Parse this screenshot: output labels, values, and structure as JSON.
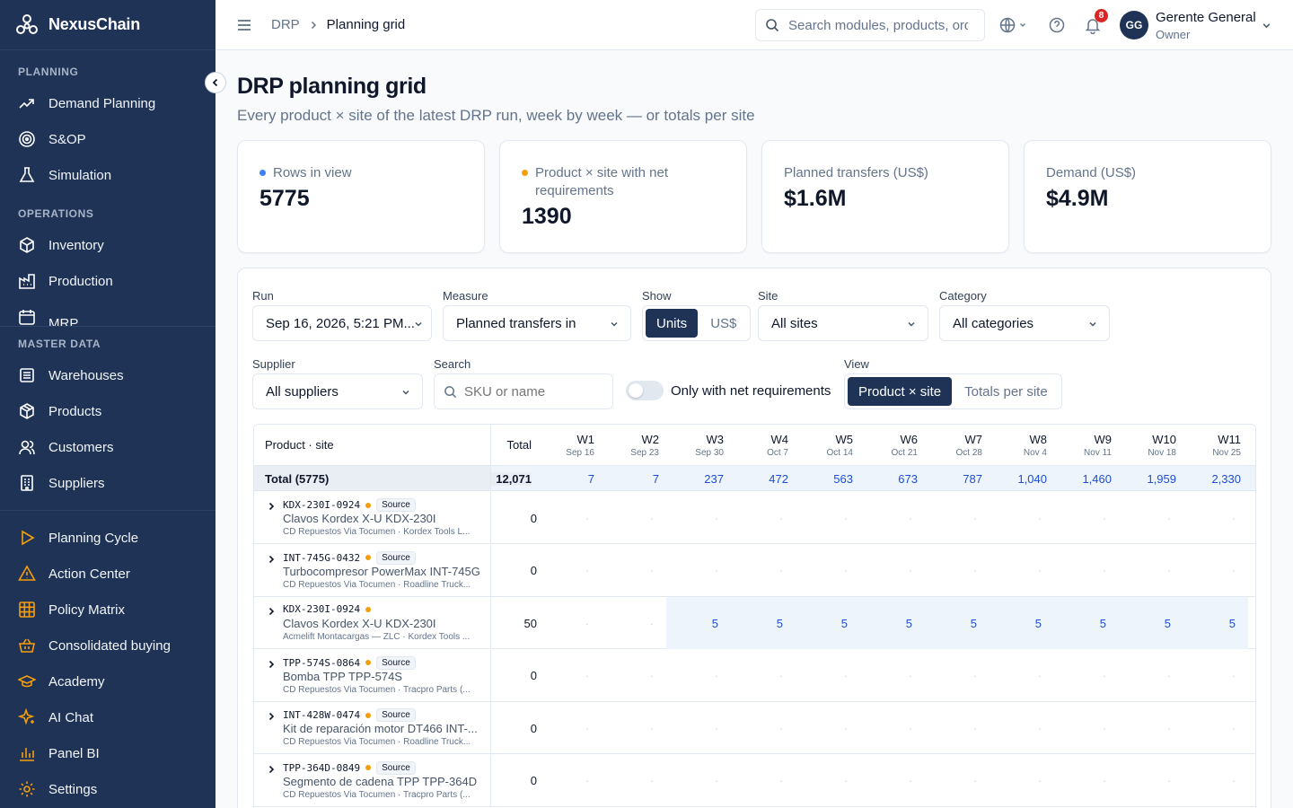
{
  "app": {
    "brand": "NexusChain"
  },
  "sidebar": {
    "sections": {
      "planning": "PLANNING",
      "operations": "OPERATIONS",
      "master_data": "MASTER DATA"
    },
    "planning_items": [
      {
        "label": "Demand Planning",
        "icon": "trend-up-icon"
      },
      {
        "label": "S&OP",
        "icon": "target-icon"
      },
      {
        "label": "Simulation",
        "icon": "flask-icon"
      }
    ],
    "operations_items": [
      {
        "label": "Inventory",
        "icon": "box-icon"
      },
      {
        "label": "Production",
        "icon": "factory-icon"
      },
      {
        "label": "MRP",
        "icon": "calendar-icon"
      }
    ],
    "master_items": [
      {
        "label": "Warehouses",
        "icon": "warehouse-icon"
      },
      {
        "label": "Products",
        "icon": "package-icon"
      },
      {
        "label": "Customers",
        "icon": "users-icon"
      },
      {
        "label": "Suppliers",
        "icon": "building-icon"
      }
    ],
    "bottom_items": [
      {
        "label": "Planning Cycle",
        "icon": "play-icon"
      },
      {
        "label": "Action Center",
        "icon": "alert-triangle-icon"
      },
      {
        "label": "Policy Matrix",
        "icon": "grid-icon"
      },
      {
        "label": "Consolidated buying",
        "icon": "basket-icon"
      },
      {
        "label": "Academy",
        "icon": "graduation-cap-icon"
      },
      {
        "label": "AI Chat",
        "icon": "sparkles-icon"
      },
      {
        "label": "Panel BI",
        "icon": "bar-chart-icon"
      },
      {
        "label": "Settings",
        "icon": "gear-icon"
      }
    ]
  },
  "topbar": {
    "breadcrumb_root": "DRP",
    "breadcrumb_current": "Planning grid",
    "search_placeholder": "Search modules, products, orders",
    "notifications": "8",
    "avatar_initials": "GG",
    "user_name": "Gerente General",
    "user_role": "Owner"
  },
  "page": {
    "title": "DRP planning grid",
    "subtitle": "Every product × site of the latest DRP run, week by week — or totals per site"
  },
  "kpis": [
    {
      "label": "Rows in view",
      "value": "5775",
      "dot_color": "#3b82f6"
    },
    {
      "label": "Product × site with net requirements",
      "value": "1390",
      "dot_color": "#f59e0b"
    },
    {
      "label": "Planned transfers (US$)",
      "value": "$1.6M"
    },
    {
      "label": "Demand (US$)",
      "value": "$4.9M"
    }
  ],
  "filters": {
    "run_label": "Run",
    "run_value": "Sep 16, 2026, 5:21 PM...",
    "measure_label": "Measure",
    "measure_value": "Planned transfers in",
    "show_label": "Show",
    "show_units": "Units",
    "show_usd": "US$",
    "site_label": "Site",
    "site_value": "All sites",
    "category_label": "Category",
    "category_value": "All categories",
    "supplier_label": "Supplier",
    "supplier_value": "All suppliers",
    "search_label": "Search",
    "search_placeholder": "SKU or name",
    "net_req_toggle": "Only with net requirements",
    "view_label": "View",
    "view_product_site": "Product × site",
    "view_totals": "Totals per site"
  },
  "grid": {
    "col_product": "Product · site",
    "col_total": "Total",
    "weeks": [
      {
        "w": "W1",
        "d": "Sep 16"
      },
      {
        "w": "W2",
        "d": "Sep 23"
      },
      {
        "w": "W3",
        "d": "Sep 30"
      },
      {
        "w": "W4",
        "d": "Oct 7"
      },
      {
        "w": "W5",
        "d": "Oct 14"
      },
      {
        "w": "W6",
        "d": "Oct 21"
      },
      {
        "w": "W7",
        "d": "Oct 28"
      },
      {
        "w": "W8",
        "d": "Nov 4"
      },
      {
        "w": "W9",
        "d": "Nov 11"
      },
      {
        "w": "W10",
        "d": "Nov 18"
      },
      {
        "w": "W11",
        "d": "Nov 25"
      }
    ],
    "total_row": {
      "label": "Total (5775)",
      "total": "12,071",
      "values": [
        "7",
        "7",
        "237",
        "472",
        "563",
        "673",
        "787",
        "1,040",
        "1,460",
        "1,959",
        "2,330"
      ]
    },
    "rows": [
      {
        "sku": "KDX-230I-0924",
        "source": "Source",
        "name": "Clavos Kordex X-U KDX-230I",
        "site": "CD Repuestos Via Tocumen · Kordex Tools L...",
        "total": "0",
        "values": [
          "·",
          "·",
          "·",
          "·",
          "·",
          "·",
          "·",
          "·",
          "·",
          "·",
          "·"
        ],
        "highlight_from": -1
      },
      {
        "sku": "INT-745G-0432",
        "source": "Source",
        "name": "Turbocompresor PowerMax INT-745G",
        "site": "CD Repuestos Via Tocumen · Roadline Truck...",
        "total": "0",
        "values": [
          "·",
          "·",
          "·",
          "·",
          "·",
          "·",
          "·",
          "·",
          "·",
          "·",
          "·"
        ],
        "highlight_from": -1
      },
      {
        "sku": "KDX-230I-0924",
        "source": "",
        "name": "Clavos Kordex X-U KDX-230I",
        "site": "Acmelift Montacargas — ZLC · Kordex Tools ...",
        "total": "50",
        "values": [
          "·",
          "·",
          "5",
          "5",
          "5",
          "5",
          "5",
          "5",
          "5",
          "5",
          "5"
        ],
        "highlight_from": 2
      },
      {
        "sku": "TPP-574S-0864",
        "source": "Source",
        "name": "Bomba TPP TPP-574S",
        "site": "CD Repuestos Via Tocumen · Tracpro Parts (...",
        "total": "0",
        "values": [
          "·",
          "·",
          "·",
          "·",
          "·",
          "·",
          "·",
          "·",
          "·",
          "·",
          "·"
        ],
        "highlight_from": -1
      },
      {
        "sku": "INT-428W-0474",
        "source": "Source",
        "name": "Kit de reparación motor DT466 INT-...",
        "site": "CD Repuestos Via Tocumen · Roadline Truck...",
        "total": "0",
        "values": [
          "·",
          "·",
          "·",
          "·",
          "·",
          "·",
          "·",
          "·",
          "·",
          "·",
          "·"
        ],
        "highlight_from": -1
      },
      {
        "sku": "TPP-364D-0849",
        "source": "Source",
        "name": "Segmento de cadena TPP TPP-364D",
        "site": "CD Repuestos Via Tocumen · Tracpro Parts (...",
        "total": "0",
        "values": [
          "·",
          "·",
          "·",
          "·",
          "·",
          "·",
          "·",
          "·",
          "·",
          "·",
          "·"
        ],
        "highlight_from": -1
      }
    ]
  }
}
